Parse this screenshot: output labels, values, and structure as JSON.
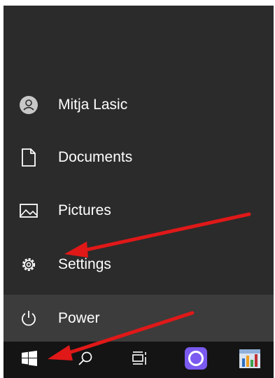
{
  "start_menu": {
    "items": [
      {
        "label": "Mitja Lasic",
        "icon": "user-avatar-icon"
      },
      {
        "label": "Documents",
        "icon": "document-icon"
      },
      {
        "label": "Pictures",
        "icon": "picture-icon"
      },
      {
        "label": "Settings",
        "icon": "gear-icon"
      },
      {
        "label": "Power",
        "icon": "power-icon"
      }
    ]
  },
  "taskbar": {
    "buttons": [
      {
        "icon": "windows-logo-icon"
      },
      {
        "icon": "search-icon"
      },
      {
        "icon": "task-view-icon"
      },
      {
        "icon": "cortana-ring-icon"
      },
      {
        "icon": "app-chart-icon"
      }
    ]
  },
  "colors": {
    "menu_bg": "#2b2b2b",
    "power_row_bg": "#3c3c3c",
    "taskbar_bg": "#141414",
    "annotation_arrow": "#e01818"
  }
}
